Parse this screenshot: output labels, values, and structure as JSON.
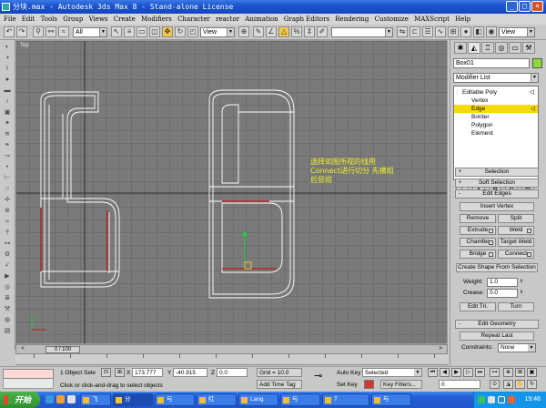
{
  "window": {
    "title": "分块.max - Autodesk 3ds Max 8 - Stand-alone License",
    "min": "_",
    "max": "□",
    "close": "×"
  },
  "menu": [
    "File",
    "Edit",
    "Tools",
    "Group",
    "Views",
    "Create",
    "Modifiers",
    "Character",
    "reactor",
    "Animation",
    "Graph Editors",
    "Rendering",
    "Customize",
    "MAXScript",
    "Help"
  ],
  "toolbar": {
    "selection_filter": "All",
    "ref_coord": "View",
    "named_sel": "",
    "render_view": "View"
  },
  "viewport": {
    "label": "Top",
    "note_lines": [
      "选择如图所视的线用",
      "Connect进行切分 先横组",
      "后竖组"
    ]
  },
  "time": {
    "slider_label": "0 / 100",
    "prev": "<",
    "next": ">"
  },
  "cmdpanel": {
    "object_name": "Box01",
    "modifier_list": "Modifier List",
    "stack": [
      {
        "label": "Editable Poly",
        "sel": false
      },
      {
        "label": "Vertex",
        "sel": false
      },
      {
        "label": "Edge",
        "sel": true
      },
      {
        "label": "Border",
        "sel": false
      },
      {
        "label": "Polygon",
        "sel": false
      },
      {
        "label": "Element",
        "sel": false
      }
    ],
    "rollouts": {
      "selection": "Selection",
      "soft_selection": "Soft Selection",
      "edit_edges": "Edit Edges",
      "edit_geometry": "Edit Geometry"
    },
    "buttons": {
      "insert_vertex": "Insert Vertex",
      "remove": "Remove",
      "split": "Split",
      "extrude": "Extrude",
      "weld": "Weld",
      "chamfer": "Chamfer",
      "target_weld": "Target Weld",
      "bridge": "Bridge",
      "connect": "Connect",
      "create_shape": "Create Shape From Selection",
      "edit_tri": "Edit Tri.",
      "turn": "Turn",
      "repeat_last": "Repeat Last"
    },
    "weight_label": "Weight:",
    "weight_value": "1.0",
    "crease_label": "Crease:",
    "crease_value": "0.0",
    "constraints_label": "Constraints:",
    "constraints_value": "None",
    "plus": "+",
    "minus": "-"
  },
  "status": {
    "selection": "1 Object Sele",
    "x_label": "X",
    "x_value": "173.777",
    "y_label": "Y",
    "y_value": "-40.915",
    "z_label": "Z",
    "z_value": "0.0",
    "grid": "Grid = 10.0",
    "prompt": "Click or click-and-drag to select objects",
    "add_time_tag": "Add Time Tag",
    "auto_key": "Auto Key",
    "set_key": "Set Key",
    "key_mode": "Selected",
    "key_filters": "Key Filters...",
    "frame": "0"
  },
  "taskbar": {
    "start": "开始",
    "tasks": [
      "飞",
      "分",
      "与",
      "红",
      "Lang",
      "与",
      "T",
      "与"
    ],
    "clock": "19:46"
  },
  "colors": {
    "selected_edge": "#c01818",
    "stack_sel": "#f6d90a",
    "note_text": "#f2f12a"
  }
}
